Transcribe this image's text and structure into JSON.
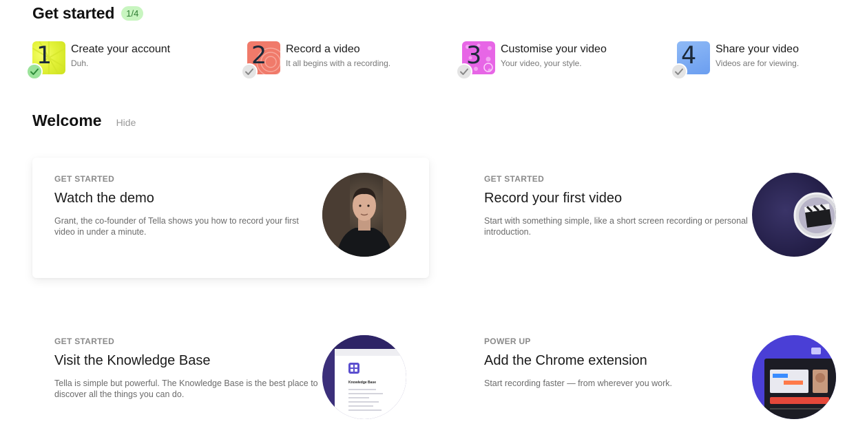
{
  "get_started": {
    "title": "Get started",
    "progress": "1/4",
    "steps": [
      {
        "number": "1",
        "title": "Create your account",
        "subtitle": "Duh.",
        "done": true,
        "icon": "check-icon"
      },
      {
        "number": "2",
        "title": "Record a video",
        "subtitle": "It all begins with a recording.",
        "done": false,
        "icon": "check-icon"
      },
      {
        "number": "3",
        "title": "Customise your video",
        "subtitle": "Your video, your style.",
        "done": false,
        "icon": "check-icon"
      },
      {
        "number": "4",
        "title": "Share your video",
        "subtitle": "Videos are for viewing.",
        "done": false,
        "icon": "check-icon"
      }
    ]
  },
  "welcome": {
    "title": "Welcome",
    "hide_label": "Hide"
  },
  "cards": [
    {
      "kicker": "GET STARTED",
      "title": "Watch the demo",
      "description": "Grant, the co-founder of Tella shows you how to record your first video in under a minute.",
      "image": "founder-portrait"
    },
    {
      "kicker": "GET STARTED",
      "title": "Record your first video",
      "description": "Start with something simple, like a short screen recording or personal introduction.",
      "image": "clapperboard-disc-icon"
    },
    {
      "kicker": "GET STARTED",
      "title": "Visit the Knowledge Base",
      "description": "Tella is simple but powerful. The Knowledge Base is the best place to discover all the things you can do.",
      "image": "knowledge-base-preview",
      "preview_heading": "Knowledge Base"
    },
    {
      "kicker": "POWER UP",
      "title": "Add the Chrome extension",
      "description": "Start recording faster — from wherever you work.",
      "image": "chrome-extension-preview"
    }
  ],
  "colors": {
    "badge_bg": "#c8f5c0",
    "badge_text": "#2e7d32",
    "step1": "#e3f23a",
    "step2": "#f07a6a",
    "step3": "#e766e6",
    "step4": "#7aaaf0",
    "check_done": "#9be39a",
    "check_todo": "#e4e4e4"
  }
}
